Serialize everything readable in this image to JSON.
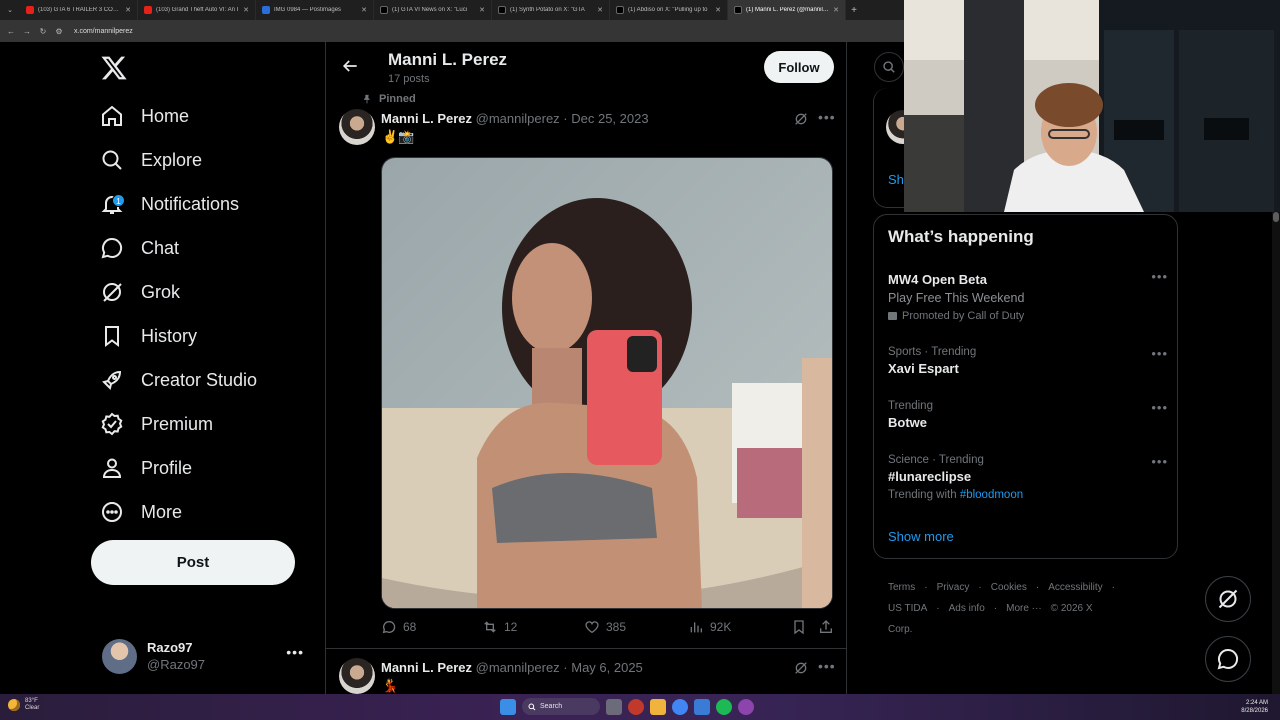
{
  "browser": {
    "tabs": [
      {
        "favicon": "yt",
        "title": "(103) GTA 6 TRAILER 3 COMPLE"
      },
      {
        "favicon": "yt",
        "title": "(103) Grand Theft Auto VI: An I"
      },
      {
        "favicon": "p",
        "title": "IMG 0984 — Postimages"
      },
      {
        "favicon": "x",
        "title": "(1) GTA VI News on X: \"Luci"
      },
      {
        "favicon": "x",
        "title": "(1) Synth Potato on X: \"GTA"
      },
      {
        "favicon": "x",
        "title": "(1) Abdiso on X: \"Pulling up to"
      },
      {
        "favicon": "x",
        "title": "(1) Manni L. Perez (@mannilper"
      }
    ],
    "active_tab": 6,
    "url": "x.com/mannilperez"
  },
  "sidebar": {
    "items": [
      {
        "label": "Home",
        "icon": "home-icon"
      },
      {
        "label": "Explore",
        "icon": "search-icon"
      },
      {
        "label": "Notifications",
        "icon": "bell-icon",
        "badge": "1"
      },
      {
        "label": "Chat",
        "icon": "chat-icon"
      },
      {
        "label": "Grok",
        "icon": "grok-icon"
      },
      {
        "label": "History",
        "icon": "bookmark-icon"
      },
      {
        "label": "Creator Studio",
        "icon": "rocket-icon"
      },
      {
        "label": "Premium",
        "icon": "verified-icon"
      },
      {
        "label": "Profile",
        "icon": "person-icon"
      },
      {
        "label": "More",
        "icon": "more-circle-icon"
      }
    ],
    "post_label": "Post",
    "account": {
      "name": "Razo97",
      "handle": "@Razo97"
    }
  },
  "profile_header": {
    "name": "Manni L. Perez",
    "posts_count": "17 posts",
    "follow_label": "Follow"
  },
  "tweets": [
    {
      "pinned_label": "Pinned",
      "name": "Manni L. Perez",
      "handle": "@mannilperez",
      "date": "· Dec 25, 2023",
      "text": "✌️📸",
      "replies": "68",
      "reposts": "12",
      "likes": "385",
      "views": "92K"
    },
    {
      "name": "Manni L. Perez",
      "handle": "@mannilperez",
      "date": "· May 6, 2025",
      "text": "💃"
    }
  ],
  "right": {
    "show_link": "Sh",
    "trends_title": "What’s happening",
    "trends": [
      {
        "context": "",
        "title": "MW4 Open Beta",
        "sub": "Play Free This Weekend",
        "promo": "Promoted by Call of Duty"
      },
      {
        "context": "Sports · Trending",
        "title": "Xavi Espart"
      },
      {
        "context": "Trending",
        "title": "Botwe"
      },
      {
        "context": "Science · Trending",
        "title": "#lunareclipse",
        "trending_with_prefix": "Trending with",
        "trending_with_tag": "#bloodmoon"
      }
    ],
    "show_more": "Show more",
    "footer_row1": [
      "Terms",
      "·",
      "Privacy",
      "·",
      "Cookies",
      "·",
      "Accessibility",
      "·"
    ],
    "footer_row2": [
      "US TIDA",
      "·",
      "Ads info",
      "·",
      "More ···",
      "© 2026 X Corp."
    ]
  },
  "taskbar": {
    "weather_temp": "83°F",
    "weather_desc": "Clear",
    "search_label": "Search",
    "time": "2:24 AM",
    "date": "8/28/2026"
  },
  "colors": {
    "accent": "#1d9bf0",
    "background": "#000000",
    "muted": "#71767b"
  }
}
